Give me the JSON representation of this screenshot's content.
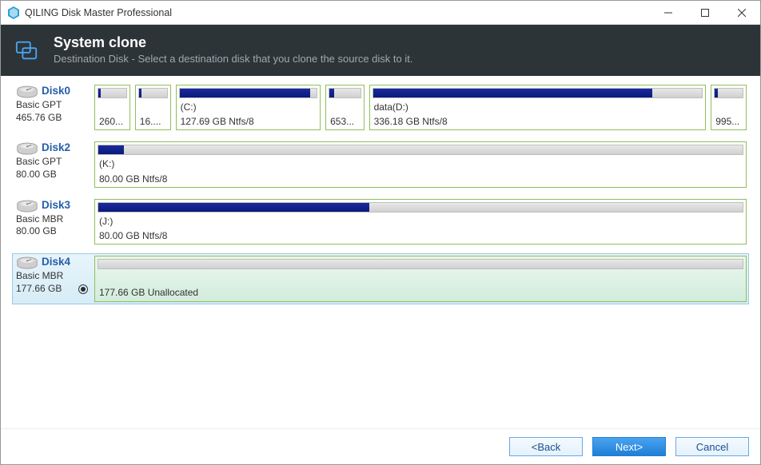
{
  "window": {
    "title": "QILING Disk Master Professional"
  },
  "header": {
    "title": "System clone",
    "subtitle": "Destination Disk - Select a destination disk that you clone the source disk to it."
  },
  "disks": [
    {
      "name": "Disk0",
      "type": "Basic GPT",
      "size": "465.76 GB",
      "selected": false,
      "checked": false,
      "partitions": [
        {
          "label1": "",
          "label2": "260...",
          "fill": 10,
          "flex": 4.2
        },
        {
          "label1": "",
          "label2": "16....",
          "fill": 10,
          "flex": 4.2
        },
        {
          "label1": "(C:)",
          "label2": "127.69 GB Ntfs/8",
          "fill": 95,
          "flex": 19
        },
        {
          "label1": "",
          "label2": "653...",
          "fill": 15,
          "flex": 4.6
        },
        {
          "label1": "data(D:)",
          "label2": "336.18 GB Ntfs/8",
          "fill": 85,
          "flex": 45
        },
        {
          "label1": "",
          "label2": "995...",
          "fill": 12,
          "flex": 4.2
        }
      ]
    },
    {
      "name": "Disk2",
      "type": "Basic GPT",
      "size": "80.00 GB",
      "selected": false,
      "checked": false,
      "partitions": [
        {
          "label1": "(K:)",
          "label2": "80.00 GB Ntfs/8",
          "fill": 4,
          "flex": 100
        }
      ]
    },
    {
      "name": "Disk3",
      "type": "Basic MBR",
      "size": "80.00 GB",
      "selected": false,
      "checked": false,
      "partitions": [
        {
          "label1": "(J:)",
          "label2": "80.00 GB Ntfs/8",
          "fill": 42,
          "flex": 100
        }
      ]
    },
    {
      "name": "Disk4",
      "type": "Basic MBR",
      "size": "177.66 GB",
      "selected": true,
      "checked": true,
      "partitions": [
        {
          "label1": "",
          "label2": "177.66 GB Unallocated",
          "fill": 0,
          "flex": 100,
          "selected": true
        }
      ]
    }
  ],
  "footer": {
    "back": "<Back",
    "next": "Next>",
    "cancel": "Cancel"
  }
}
